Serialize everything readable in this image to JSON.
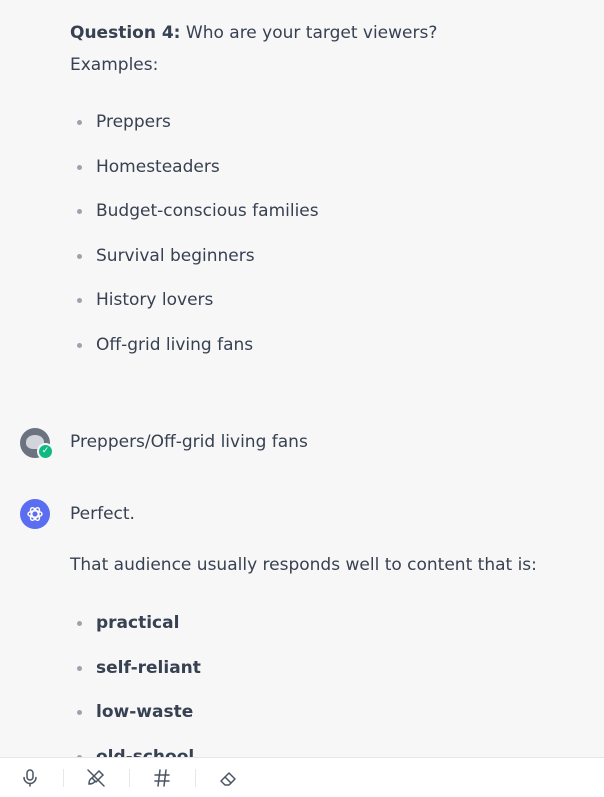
{
  "conversation": {
    "question": {
      "label": "Question 4:",
      "text": " Who are your target viewers?",
      "examples_label": "Examples:",
      "examples": [
        "Preppers",
        "Homesteaders",
        "Budget-conscious families",
        "Survival beginners",
        "History lovers",
        "Off-grid living fans"
      ]
    },
    "user_message": "Preppers/Off-grid living fans",
    "assistant_reply": {
      "opening": "Perfect.",
      "intro": "That audience usually responds well to content that is:",
      "traits": [
        "practical",
        "self-reliant",
        "low-waste",
        "old-school"
      ]
    }
  },
  "toolbar": {
    "icons": [
      "microphone-icon",
      "brush-off-icon",
      "hashtag-icon",
      "eraser-icon"
    ]
  }
}
